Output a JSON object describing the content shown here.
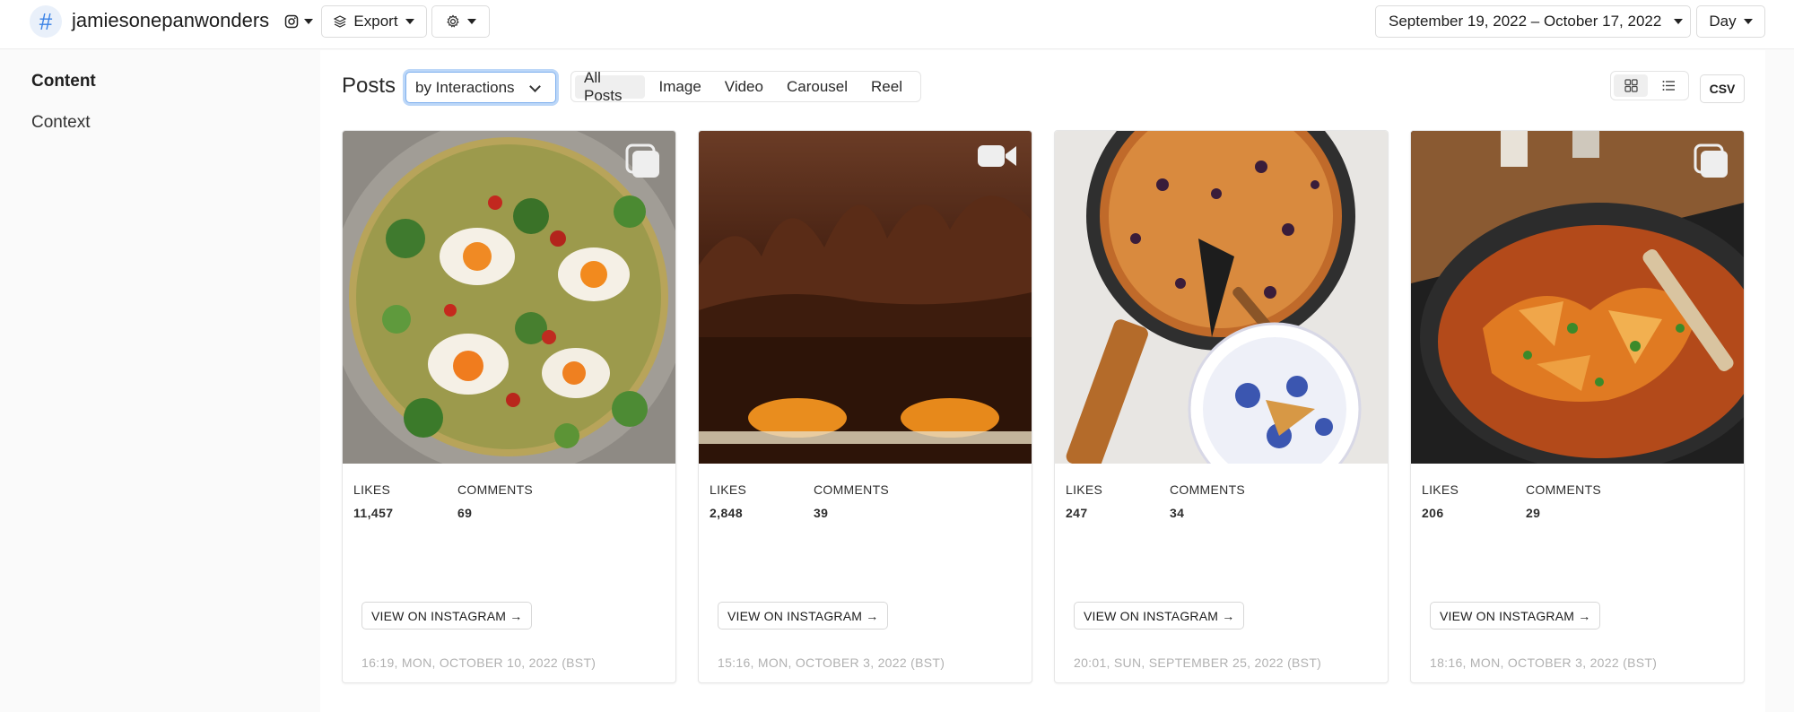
{
  "header": {
    "logo_glyph": "#",
    "account_name": "jamiesonepanwonders",
    "platform_icon": "instagram-icon",
    "export_label": "Export",
    "settings_icon": "gear-icon",
    "date_range": "September 19, 2022 – October 17, 2022",
    "granularity": "Day"
  },
  "sidebar": {
    "items": [
      {
        "label": "Content",
        "active": true
      },
      {
        "label": "Context",
        "active": false
      }
    ]
  },
  "toolbar": {
    "title": "Posts",
    "sort_value": "by Interactions",
    "filters": [
      {
        "label": "All Posts",
        "active": true
      },
      {
        "label": "Image",
        "active": false
      },
      {
        "label": "Video",
        "active": false
      },
      {
        "label": "Carousel",
        "active": false
      },
      {
        "label": "Reel",
        "active": false
      }
    ],
    "view_modes": [
      {
        "name": "grid-view",
        "active": true
      },
      {
        "name": "list-view",
        "active": false
      }
    ],
    "csv_label": "CSV"
  },
  "posts": [
    {
      "type": "carousel",
      "image_desc": "green vegetables with eggs and chili oil in a pan",
      "likes_label": "LIKES",
      "likes": "11,457",
      "comments_label": "COMMENTS",
      "comments": "69",
      "cta": "VIEW ON INSTAGRAM →",
      "timestamp": "16:19, MON, OCTOBER 10, 2022 (BST)"
    },
    {
      "type": "video",
      "image_desc": "chocolate cake slice with apricot layer",
      "likes_label": "LIKES",
      "likes": "2,848",
      "comments_label": "COMMENTS",
      "comments": "39",
      "cta": "VIEW ON INSTAGRAM →",
      "timestamp": "15:16, MON, OCTOBER 3, 2022 (BST)"
    },
    {
      "type": "image",
      "image_desc": "blackberry clafoutis in a skillet with a blue plate",
      "likes_label": "LIKES",
      "likes": "247",
      "comments_label": "COMMENTS",
      "comments": "34",
      "cta": "VIEW ON INSTAGRAM →",
      "timestamp": "20:01, SUN, SEPTEMBER 25, 2022 (BST)"
    },
    {
      "type": "carousel",
      "image_desc": "pappardelle in tomato sauce in a pan on the stove",
      "likes_label": "LIKES",
      "likes": "206",
      "comments_label": "COMMENTS",
      "comments": "29",
      "cta": "VIEW ON INSTAGRAM →",
      "timestamp": "18:16, MON, OCTOBER 3, 2022 (BST)"
    }
  ],
  "colors": {
    "accent": "#3a82e6",
    "focus_ring": "#bcd7f8",
    "muted_text": "#b1b1b1"
  }
}
